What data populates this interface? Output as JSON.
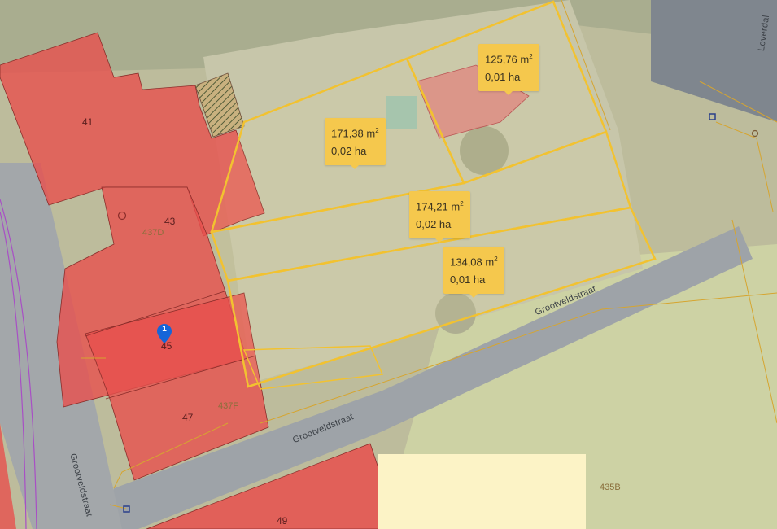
{
  "house_numbers": {
    "n41": "41",
    "n43": "43",
    "n45": "45",
    "n47": "47",
    "n49": "49"
  },
  "parcel_numbers": {
    "p437D": "437D",
    "p437F": "437F",
    "p435B": "435B"
  },
  "streets": {
    "grootveld_main": "Grootveldstraat",
    "grootveld_lower": "Grootveldstraat",
    "grootveld_vertical": "Grootveldstraat",
    "loverdal": "Loverdal"
  },
  "measurements": [
    {
      "area": "125,76 m",
      "hectares": "0,01 ha"
    },
    {
      "area": "171,38 m",
      "hectares": "0,02 ha"
    },
    {
      "area": "174,21 m",
      "hectares": "0,02 ha"
    },
    {
      "area": "134,08 m",
      "hectares": "0,01 ha"
    }
  ],
  "area_unit_exponent": "2",
  "marker": {
    "label": "1",
    "icon": "map-pin-icon"
  },
  "colors": {
    "building_fill": "#e7504d",
    "selection_outline": "#f2c230",
    "measurement_bubble": "#f5c84d",
    "marker": "#1565d8",
    "cadastral_line": "#d6a530",
    "road": "#9ea3a8"
  }
}
